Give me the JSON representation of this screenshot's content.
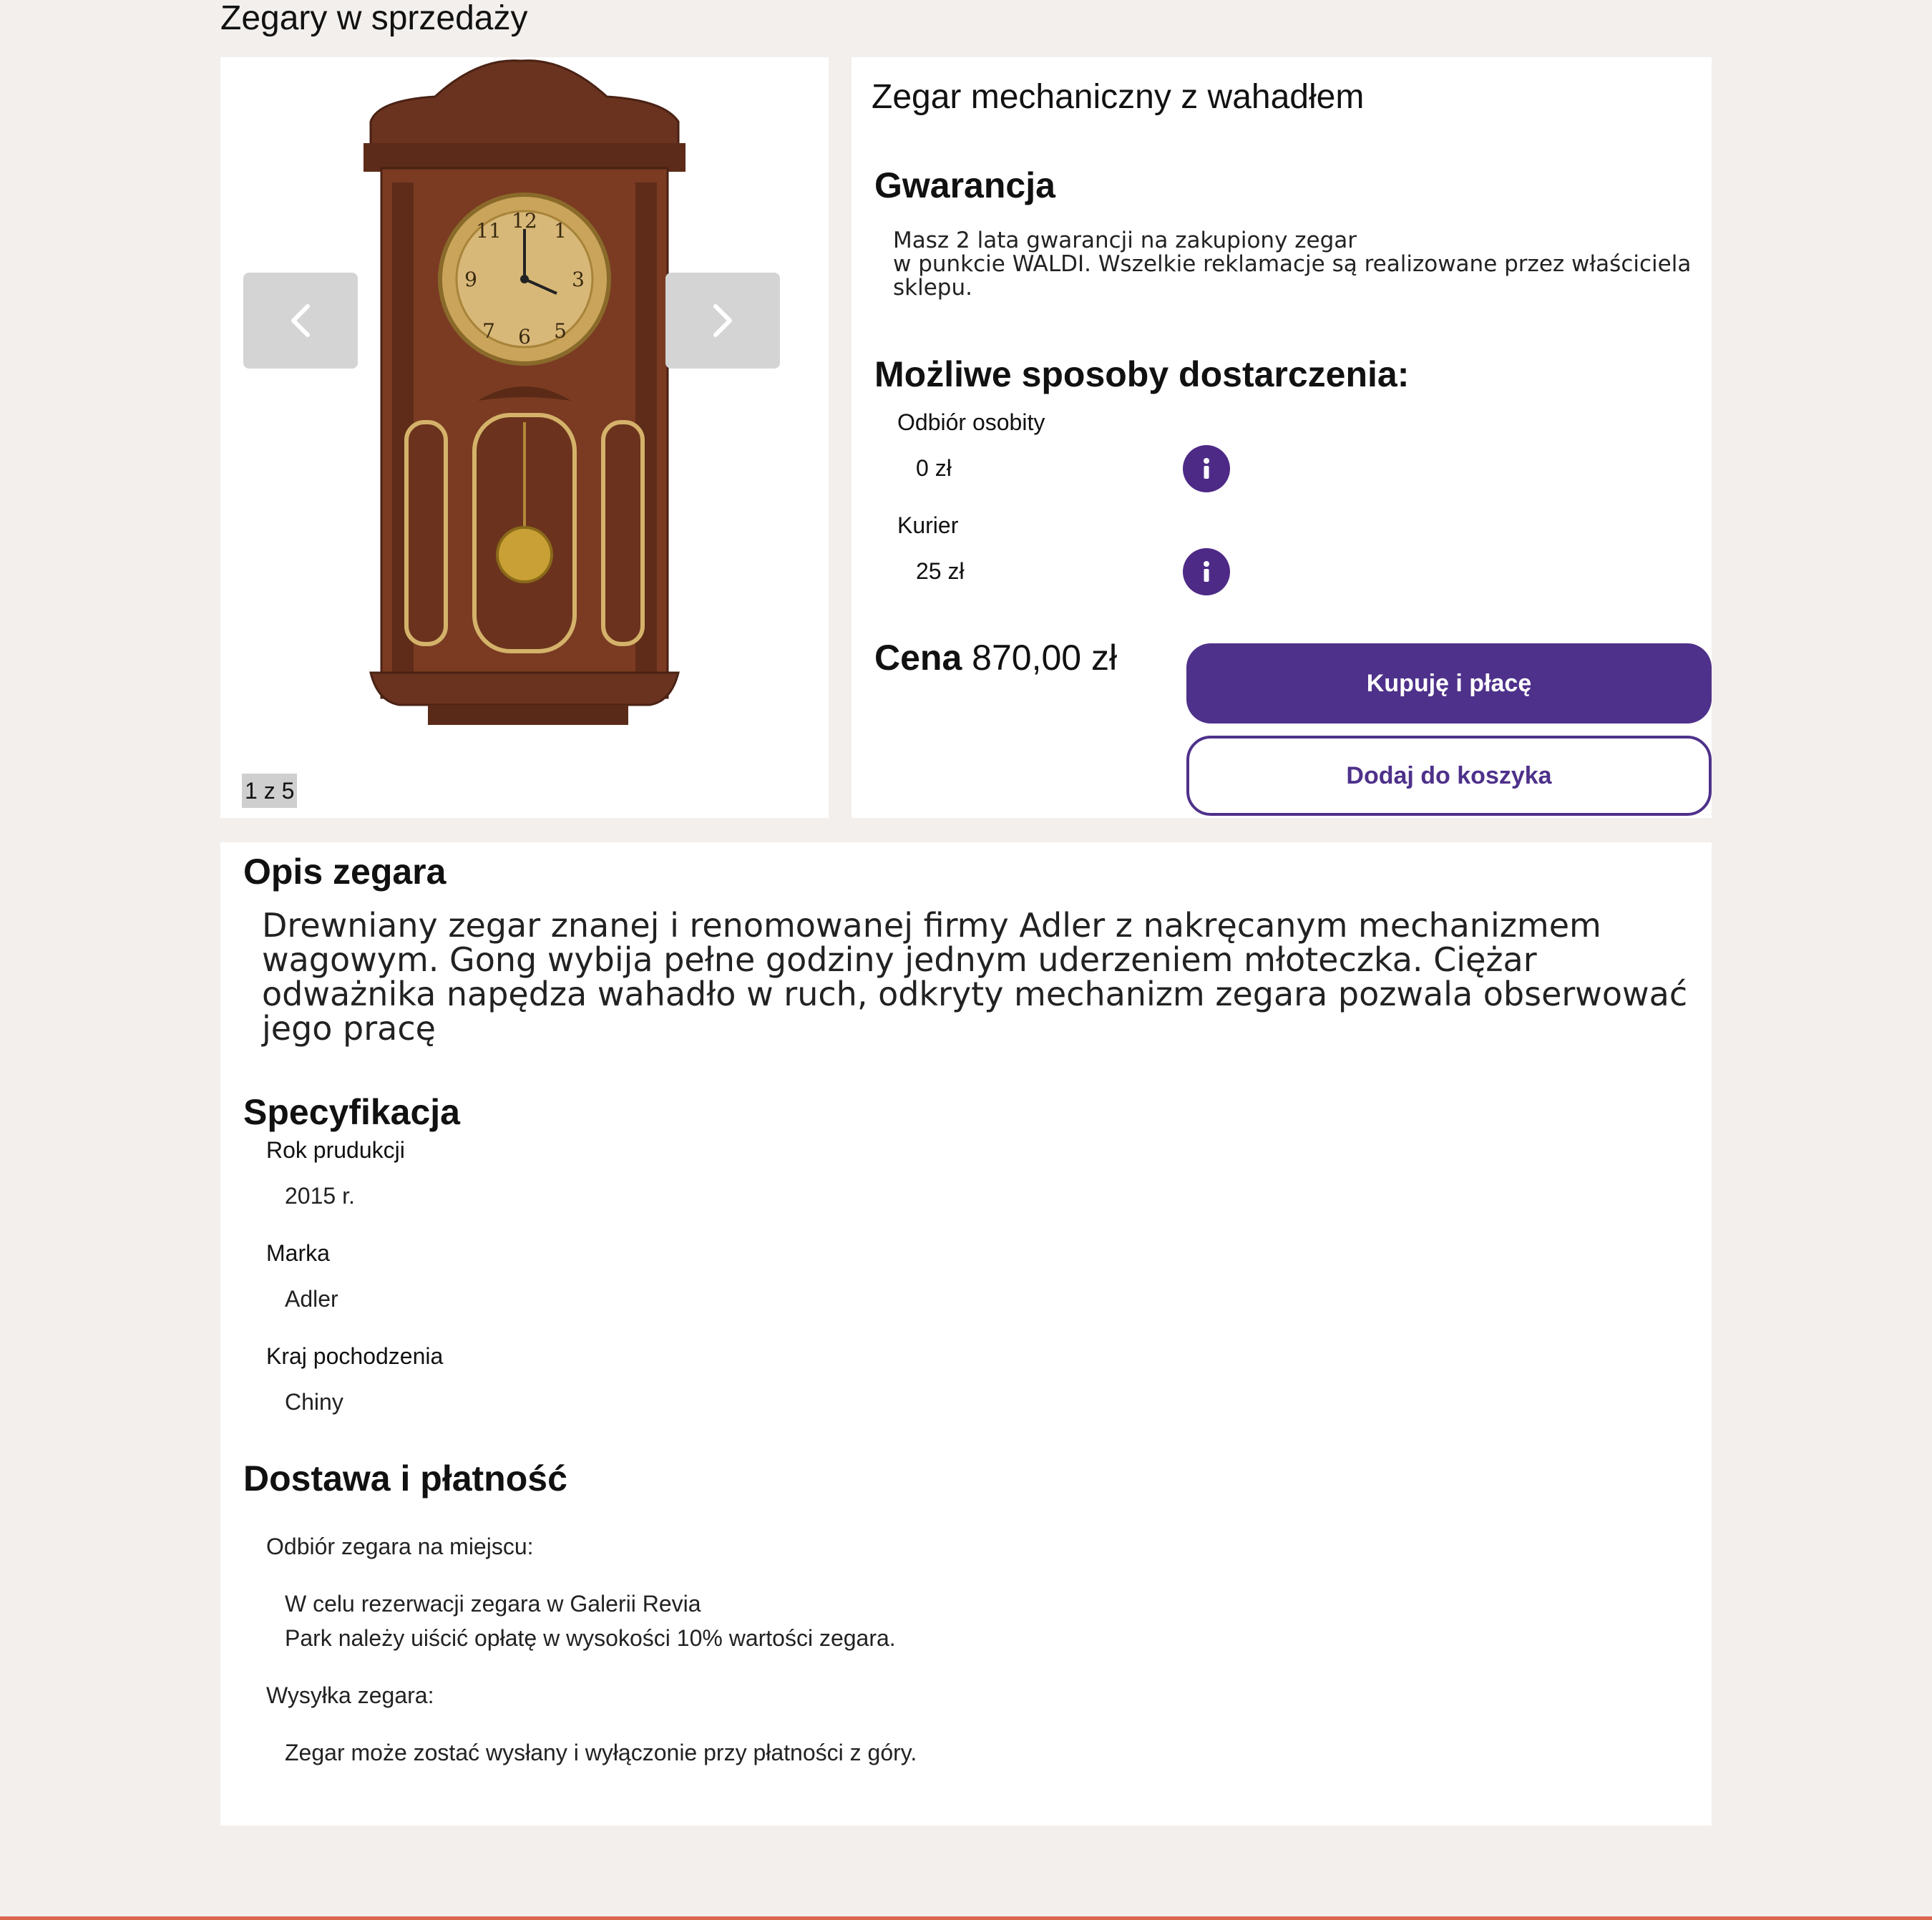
{
  "page_title": "Zegary w sprzedaży",
  "gallery": {
    "counter": "1 z 5",
    "prev_icon": "chevron-left-icon",
    "next_icon": "chevron-right-icon"
  },
  "product": {
    "title": "Zegar mechaniczny z wahadłem",
    "warranty_heading": "Gwarancja",
    "warranty_line1": "Masz 2 lata gwarancji na zakupiony zegar",
    "warranty_line2": "w punkcie WALDI. Wszelkie reklamacje są realizowane przez właściciela",
    "warranty_line3": "sklepu.",
    "delivery_heading": "Możliwe sposoby dostarczenia:",
    "delivery_options": [
      {
        "name": "Odbiór osobity",
        "price": "0 zł",
        "icon": "info-icon"
      },
      {
        "name": "Kurier",
        "price": "25 zł",
        "icon": "info-icon"
      }
    ],
    "price_label": "Cena",
    "price_value": "870,00 zł",
    "buy_label": "Kupuję i płacę",
    "cart_label": "Dodaj do koszyka"
  },
  "details": {
    "description_heading": "Opis zegara",
    "description_lines": [
      "Drewniany zegar znanej i renomowanej firmy Adler z nakręcanym mechanizmem",
      "wagowym. Gong wybija pełne godziny jednym uderzeniem młoteczka. Ciężar",
      "odważnika napędza wahadło w ruch, odkryty mechanizm zegara pozwala obserwować",
      "jego pracę"
    ],
    "spec_heading": "Specyfikacja",
    "specs": [
      {
        "name": "Rok prudukcji",
        "value": "2015 r."
      },
      {
        "name": "Marka",
        "value": "Adler"
      },
      {
        "name": "Kraj pochodzenia",
        "value": "Chiny"
      }
    ],
    "shipping_heading": "Dostawa i płatność",
    "pickup_label": "Odbiór zegara na miejscu:",
    "pickup_line1": "W celu rezerwacji zegara w Galerii Revia",
    "pickup_line2": "Park należy uiścić opłatę w wysokości 10% wartości zegara.",
    "ship_label": "Wysyłka zegara:",
    "ship_text": "Zegar może zostać wysłany i wyłączonie przy płatności z góry."
  },
  "colors": {
    "accent": "#4e318a",
    "background": "#f2efec",
    "footer_line": "#d9674e"
  }
}
